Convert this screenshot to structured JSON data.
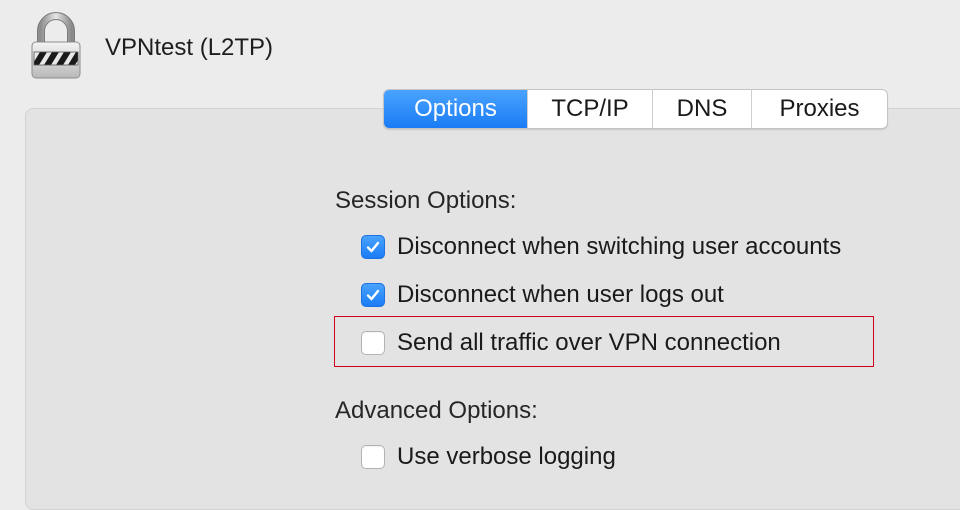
{
  "window": {
    "title": "VPNtest (L2TP)",
    "icon": "lock-icon"
  },
  "tabs": [
    {
      "label": "Options",
      "selected": true
    },
    {
      "label": "TCP/IP",
      "selected": false
    },
    {
      "label": "DNS",
      "selected": false
    },
    {
      "label": "Proxies",
      "selected": false
    }
  ],
  "session_options": {
    "heading": "Session Options:",
    "items": [
      {
        "label": "Disconnect when switching user accounts",
        "checked": true
      },
      {
        "label": "Disconnect when user logs out",
        "checked": true
      },
      {
        "label": "Send all traffic over VPN connection",
        "checked": false,
        "highlighted": true
      }
    ]
  },
  "advanced_options": {
    "heading": "Advanced Options:",
    "items": [
      {
        "label": "Use verbose logging",
        "checked": false
      }
    ]
  },
  "colors": {
    "accent": "#1a7cf5",
    "highlight_border": "#d0021b"
  }
}
